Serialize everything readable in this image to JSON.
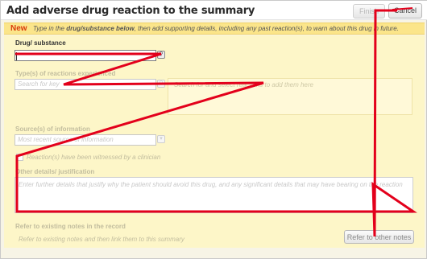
{
  "dialog": {
    "title": "Add adverse drug reaction to the summary",
    "finish_label": "Finish",
    "cancel_label": "Cancel"
  },
  "banner": {
    "new_label": "New",
    "text_pre": "Type in the ",
    "text_bold": "drug/substance below",
    "text_post": ", then add supporting details, including any past reaction(s), to warn about this drug in future."
  },
  "drug": {
    "label": "Drug/ substance",
    "value": "",
    "placeholder": ""
  },
  "reactions": {
    "label": "Type(s) of reactions experienced",
    "search_placeholder": "Search for key",
    "hint": "Search for and select reactions to add them here"
  },
  "source": {
    "label": "Source(s) of information",
    "placeholder": "Most recent source of information",
    "witness_label": "Reaction(s) have been witnessed by a clinician"
  },
  "details": {
    "label": "Other details/ justification",
    "placeholder": "Enter further details that justify why the patient should avoid this drug, and any significant details that may have bearing on the reaction"
  },
  "notes": {
    "label": "Refer to existing notes in the record",
    "hint": "Refer to existing notes and then link them to this summary",
    "button_label": "Refer to other notes"
  },
  "colors": {
    "annotation": "#e3001b",
    "banner": "#fbe58a",
    "new_tag": "#d93a0c",
    "panel": "#fdf6c8"
  }
}
